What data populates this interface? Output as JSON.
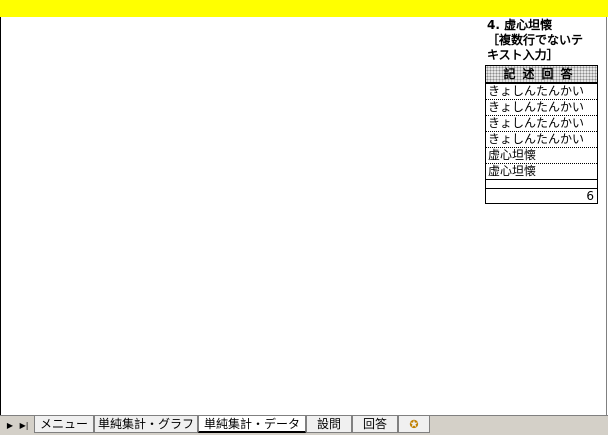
{
  "question": {
    "line1": "4. 虚心坦懐",
    "line2": "［複数行でないテ",
    "line3": "キスト入力］"
  },
  "answer_table": {
    "header": "記述回答",
    "rows": [
      "きょしんたんかい",
      "きょしんたんかい",
      "きょしんたんかい",
      "きょしんたんかい",
      "虚心坦懐",
      "虚心坦懐"
    ],
    "count": "6"
  },
  "sheet_tabs": [
    {
      "label": "メニュー"
    },
    {
      "label": "単純集計・グラフ"
    },
    {
      "label": "単純集計・データ"
    },
    {
      "label": "設問"
    },
    {
      "label": "回答"
    }
  ],
  "colors": {
    "band": "#ffff00"
  },
  "icons": {
    "nav_next": "play-next-icon",
    "nav_last": "skip-last-icon",
    "new_sheet": "new-sheet-icon"
  }
}
